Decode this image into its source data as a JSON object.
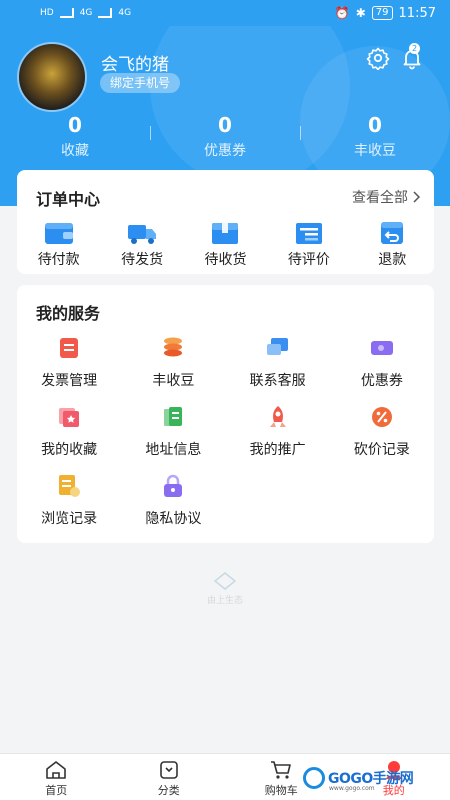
{
  "status_bar": {
    "left": [
      "HD",
      "4G",
      "4G"
    ],
    "battery": "79",
    "time": "11:57"
  },
  "profile": {
    "username": "会飞的猪",
    "bind_phone": "绑定手机号",
    "notification_count": "2"
  },
  "stats": [
    {
      "value": "0",
      "label": "收藏"
    },
    {
      "value": "0",
      "label": "优惠券"
    },
    {
      "value": "0",
      "label": "丰收豆"
    }
  ],
  "order_center": {
    "title": "订单中心",
    "view_all": "查看全部",
    "items": [
      {
        "label": "待付款",
        "icon": "wallet-icon"
      },
      {
        "label": "待发货",
        "icon": "truck-icon"
      },
      {
        "label": "待收货",
        "icon": "box-icon"
      },
      {
        "label": "待评价",
        "icon": "review-icon"
      },
      {
        "label": "退款",
        "icon": "refund-icon"
      }
    ]
  },
  "services": {
    "title": "我的服务",
    "items": [
      {
        "label": "发票管理",
        "icon": "invoice-icon",
        "color": "#f15a4a"
      },
      {
        "label": "丰收豆",
        "icon": "coins-icon",
        "color": "#f07a3a"
      },
      {
        "label": "联系客服",
        "icon": "chat-icon",
        "color": "#3a8ff0"
      },
      {
        "label": "优惠券",
        "icon": "coupon-icon",
        "color": "#8a6cf0"
      },
      {
        "label": "我的收藏",
        "icon": "favorite-icon",
        "color": "#f05a6a"
      },
      {
        "label": "地址信息",
        "icon": "address-icon",
        "color": "#3ab45a"
      },
      {
        "label": "我的推广",
        "icon": "rocket-icon",
        "color": "#f05a4a"
      },
      {
        "label": "砍价记录",
        "icon": "bargain-icon",
        "color": "#f06a3a"
      },
      {
        "label": "浏览记录",
        "icon": "history-icon",
        "color": "#f0b030"
      },
      {
        "label": "隐私协议",
        "icon": "lock-icon",
        "color": "#8a6cf0"
      }
    ]
  },
  "watermark": "由上生态",
  "bottom_nav": [
    {
      "label": "首页",
      "icon": "home-icon"
    },
    {
      "label": "分类",
      "icon": "category-icon"
    },
    {
      "label": "购物车",
      "icon": "cart-icon"
    },
    {
      "label": "我的",
      "icon": "profile-icon"
    }
  ],
  "site_logo": {
    "text": "GOGO手游网",
    "sub": "www.gogo.com"
  },
  "colors": {
    "primary": "#2ea0f2",
    "active": "#ff3a3a"
  }
}
